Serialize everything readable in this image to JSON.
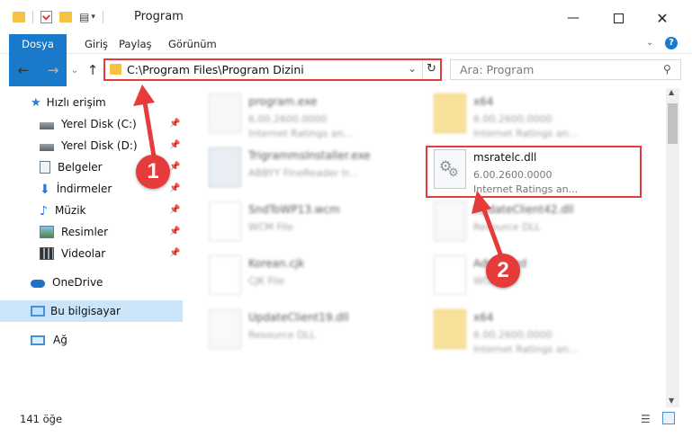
{
  "window": {
    "title": "Program"
  },
  "ribbon": {
    "tabs": [
      "Dosya",
      "Giriş",
      "Paylaş",
      "Görünüm"
    ]
  },
  "address": {
    "path": "C:\\Program Files\\Program Dizini"
  },
  "search": {
    "placeholder": "Ara: Program"
  },
  "sidebar": {
    "items": [
      {
        "label": "Hızlı erişim",
        "icon": "star-icon"
      },
      {
        "label": "Yerel Disk (C:)",
        "icon": "drive-icon",
        "pinned": true
      },
      {
        "label": "Yerel Disk (D:)",
        "icon": "drive-icon",
        "pinned": true
      },
      {
        "label": "Belgeler",
        "icon": "documents-icon",
        "pinned": true
      },
      {
        "label": "İndirmeler",
        "icon": "download-icon",
        "pinned": true
      },
      {
        "label": "Müzik",
        "icon": "music-icon",
        "pinned": true
      },
      {
        "label": "Resimler",
        "icon": "pictures-icon",
        "pinned": true
      },
      {
        "label": "Videolar",
        "icon": "videos-icon",
        "pinned": true
      },
      {
        "label": "OneDrive",
        "icon": "cloud-icon"
      },
      {
        "label": "Bu bilgisayar",
        "icon": "computer-icon",
        "selected": true
      },
      {
        "label": "Ağ",
        "icon": "network-icon"
      }
    ]
  },
  "files": [
    {
      "name": "program.exe",
      "line1": "6.00.2600.0000",
      "line2": "Internet Ratings an...",
      "icon": "exe-icon",
      "blurred": true
    },
    {
      "name": "x64",
      "line1": "6.00.2600.0000",
      "line2": "Internet Ratings an...",
      "icon": "folder-icon",
      "blurred": true
    },
    {
      "name": "TrigrammsInstaller.exe",
      "line1": "ABBYY FineReader tr...",
      "line2": "",
      "icon": "installer-icon",
      "blurred": true
    },
    {
      "name": "msratelc.dll",
      "line1": "6.00.2600.0000",
      "line2": "Internet Ratings an...",
      "icon": "dll-gear-icon",
      "blurred": false
    },
    {
      "name": "SndToWP13.wcm",
      "line1": "WCM File",
      "line2": "",
      "icon": "file-icon",
      "blurred": true
    },
    {
      "name": "UpdateClient42.dll",
      "line1": "Resource DLL",
      "line2": "",
      "icon": "dll-gear-icon",
      "blurred": true
    },
    {
      "name": "Korean.cjk",
      "line1": "CJK File",
      "line2": "",
      "icon": "file-icon",
      "blurred": true
    },
    {
      "name": "Advanced",
      "line1": "WCM",
      "line2": "",
      "icon": "file-icon",
      "blurred": true
    },
    {
      "name": "UpdateClient19.dll",
      "line1": "Resource DLL",
      "line2": "",
      "icon": "dll-gear-icon",
      "blurred": true
    },
    {
      "name": "x64",
      "line1": "6.00.2600.0000",
      "line2": "Internet Ratings an...",
      "icon": "folder-icon",
      "blurred": true
    }
  ],
  "status": {
    "count": "141 öğe"
  },
  "markers": [
    "1",
    "2"
  ],
  "colors": {
    "accent": "#1979ca",
    "highlight": "#e53b3b",
    "selection": "#cce4f7"
  }
}
